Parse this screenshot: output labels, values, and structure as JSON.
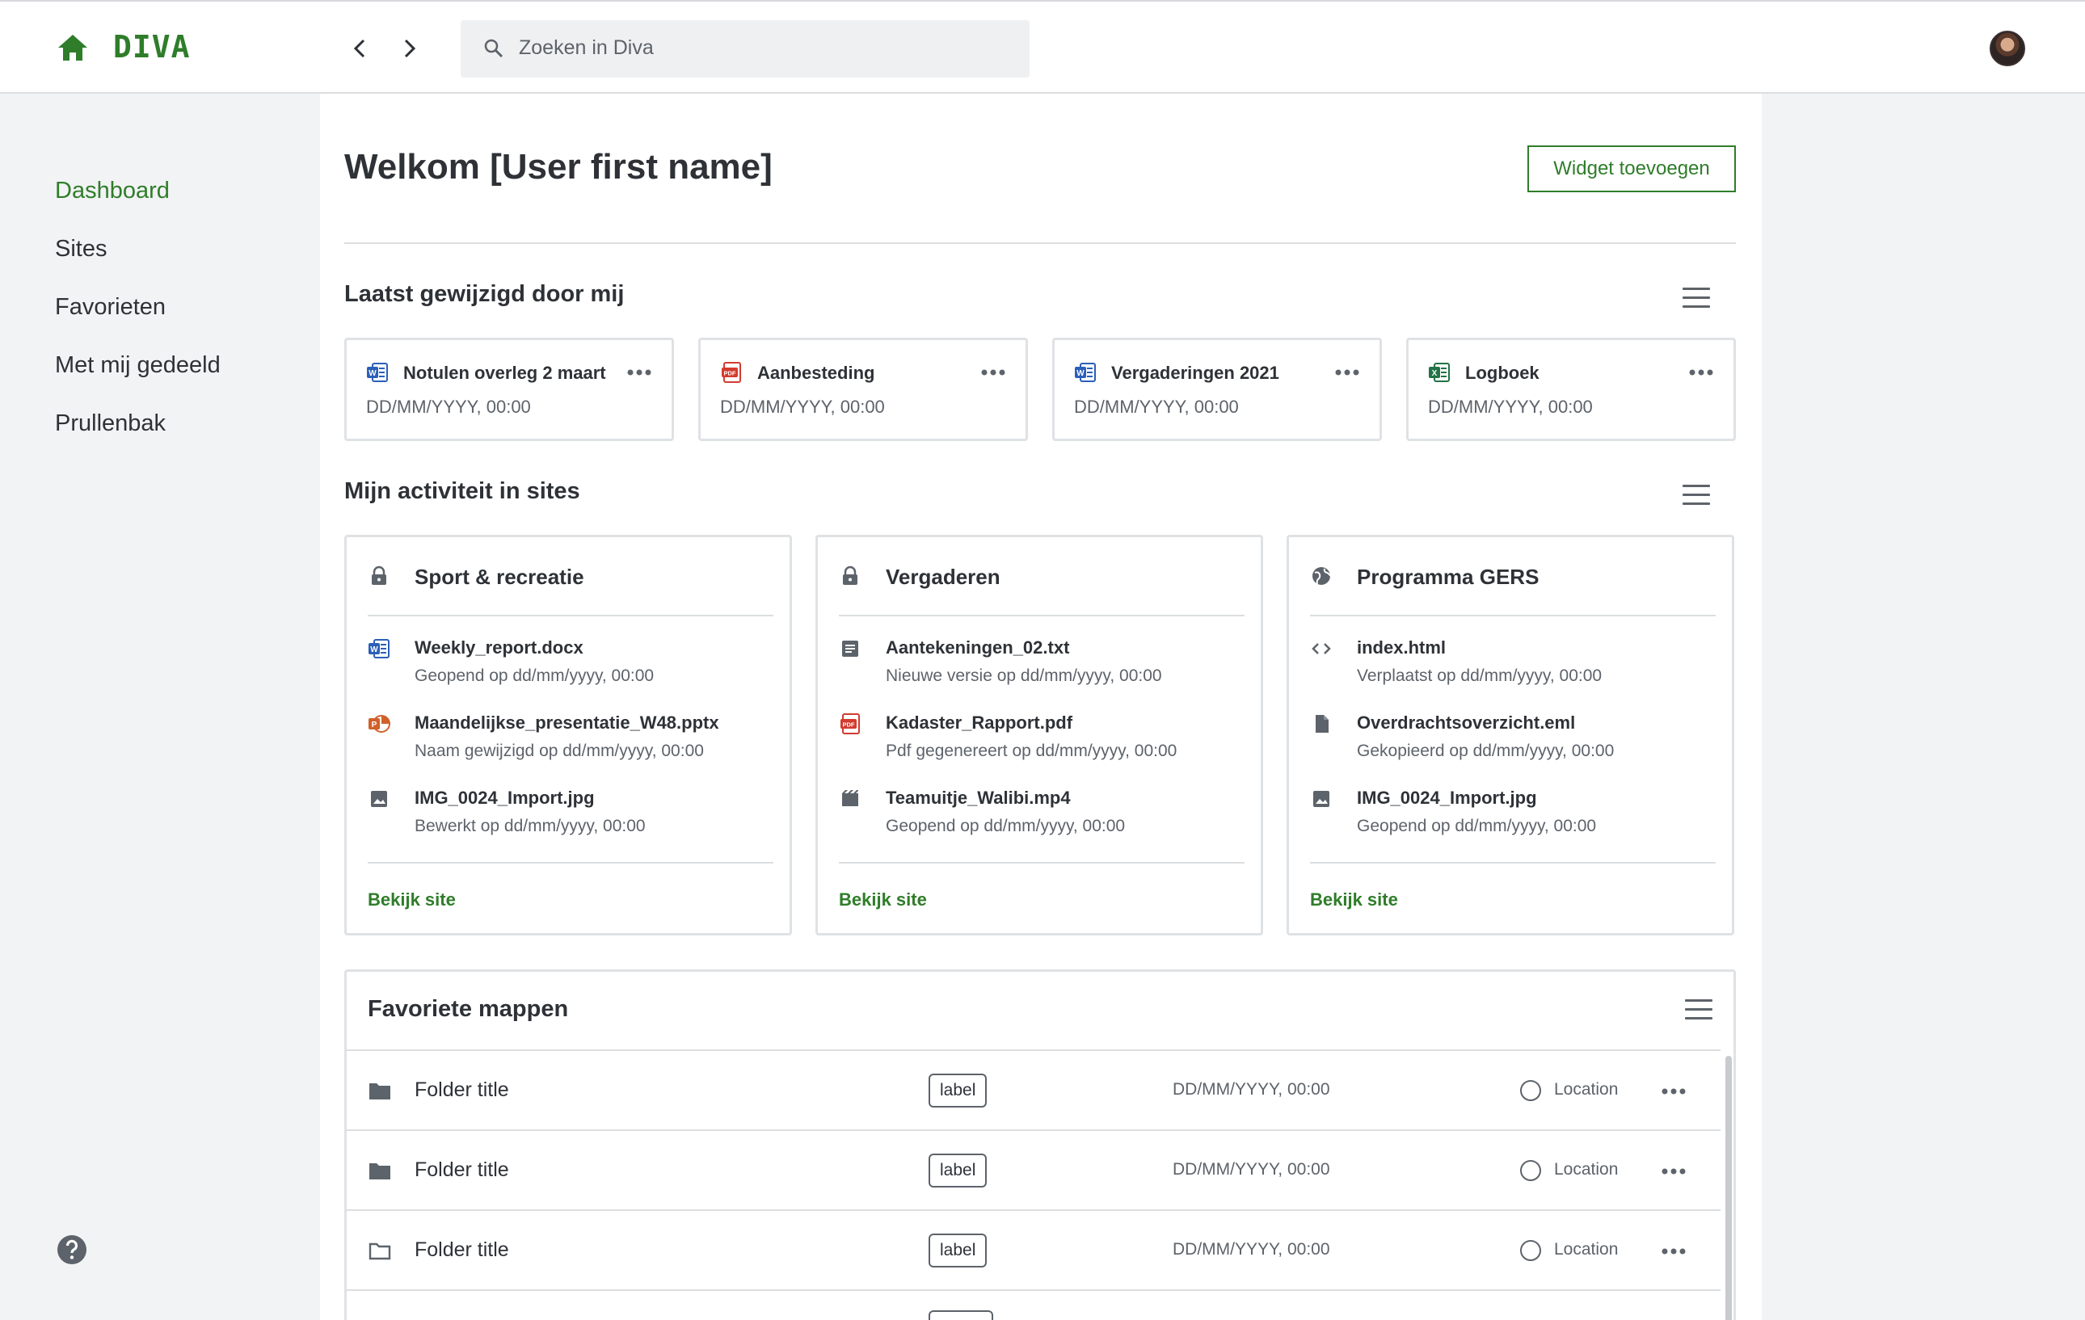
{
  "app": {
    "name": "DIVA"
  },
  "search": {
    "placeholder": "Zoeken in Diva"
  },
  "sidebar": {
    "items": [
      {
        "label": "Dashboard",
        "active": true
      },
      {
        "label": "Sites"
      },
      {
        "label": "Favorieten"
      },
      {
        "label": "Met mij gedeeld"
      },
      {
        "label": "Prullenbak"
      }
    ]
  },
  "page": {
    "title": "Welkom [User first name]",
    "add_widget_label": "Widget toevoegen"
  },
  "recent": {
    "title": "Laatst gewijzigd door mij",
    "cards": [
      {
        "name": "Notulen overleg 2 maart",
        "date": "DD/MM/YYYY, 00:00",
        "icon": "word-icon"
      },
      {
        "name": "Aanbesteding",
        "date": "DD/MM/YYYY, 00:00",
        "icon": "pdf-icon"
      },
      {
        "name": "Vergaderingen 2021",
        "date": "DD/MM/YYYY, 00:00",
        "icon": "word-icon"
      },
      {
        "name": "Logboek",
        "date": "DD/MM/YYYY, 00:00",
        "icon": "excel-icon"
      }
    ]
  },
  "activity": {
    "title": "Mijn activiteit in sites",
    "link_label": "Bekijk site",
    "sites": [
      {
        "name": "Sport & recreatie",
        "icon": "lock-icon",
        "items": [
          {
            "name": "Weekly_report.docx",
            "sub": "Geopend op dd/mm/yyyy, 00:00",
            "icon": "word-icon"
          },
          {
            "name": "Maandelijkse_presentatie_W48.pptx",
            "sub": "Naam gewijzigd op dd/mm/yyyy, 00:00",
            "icon": "powerpoint-icon"
          },
          {
            "name": "IMG_0024_Import.jpg",
            "sub": "Bewerkt op dd/mm/yyyy, 00:00",
            "icon": "image-icon"
          }
        ]
      },
      {
        "name": "Vergaderen",
        "icon": "lock-icon",
        "items": [
          {
            "name": "Aantekeningen_02.txt",
            "sub": "Nieuwe versie op dd/mm/yyyy, 00:00",
            "icon": "text-file-icon"
          },
          {
            "name": "Kadaster_Rapport.pdf",
            "sub": "Pdf gegenereert op dd/mm/yyyy, 00:00",
            "icon": "pdf-icon"
          },
          {
            "name": "Teamuitje_Walibi.mp4",
            "sub": "Geopend op dd/mm/yyyy, 00:00",
            "icon": "video-icon"
          }
        ]
      },
      {
        "name": "Programma GERS",
        "icon": "globe-icon",
        "items": [
          {
            "name": "index.html",
            "sub": "Verplaatst op dd/mm/yyyy, 00:00",
            "icon": "code-icon"
          },
          {
            "name": "Overdrachtsoverzicht.eml",
            "sub": "Gekopieerd op dd/mm/yyyy, 00:00",
            "icon": "file-icon"
          },
          {
            "name": "IMG_0024_Import.jpg",
            "sub": "Geopend op dd/mm/yyyy, 00:00",
            "icon": "image-icon"
          }
        ]
      }
    ]
  },
  "favorites": {
    "title": "Favoriete mappen",
    "rows": [
      {
        "title": "Folder title",
        "label": "label",
        "date": "DD/MM/YYYY, 00:00",
        "location": "Location",
        "icon": "folder-filled-icon"
      },
      {
        "title": "Folder title",
        "label": "label",
        "date": "DD/MM/YYYY, 00:00",
        "location": "Location",
        "icon": "folder-filled-icon"
      },
      {
        "title": "Folder title",
        "label": "label",
        "date": "DD/MM/YYYY, 00:00",
        "location": "Location",
        "icon": "folder-outline-icon"
      },
      {
        "title": "",
        "label": "",
        "date": "",
        "location": "",
        "icon": ""
      }
    ]
  },
  "colors": {
    "accent": "#2f7d2a",
    "text": "#2e3237",
    "muted": "#5d636a",
    "border": "#dfe2e5"
  }
}
